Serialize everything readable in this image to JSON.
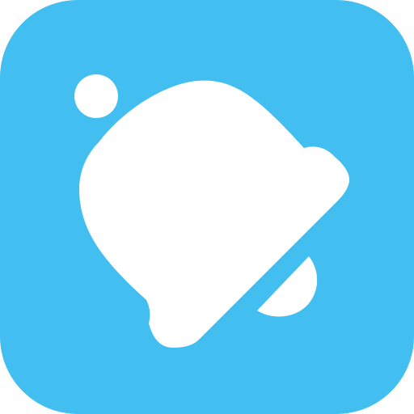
{
  "app_icon": {
    "icon": "bell-icon",
    "background_color": "#42BFF0",
    "foreground_color": "#FFFFFF"
  }
}
